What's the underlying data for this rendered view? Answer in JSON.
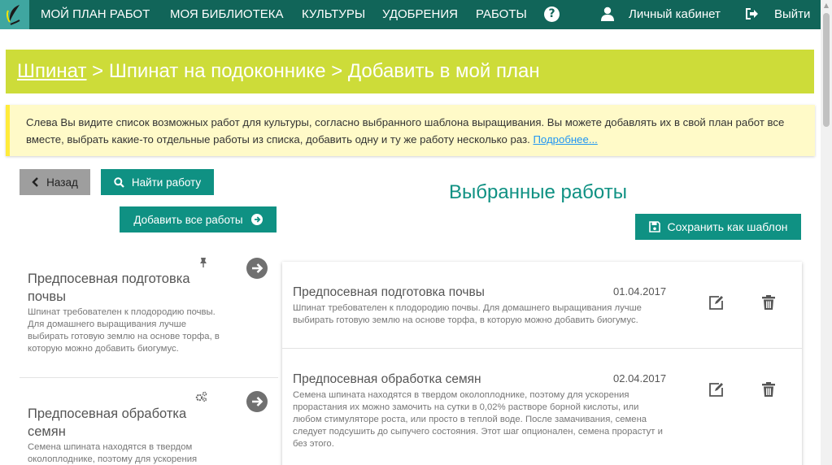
{
  "navbar": {
    "logo_icon": "leaf-logo-icon",
    "items": [
      "МОЙ ПЛАН РАБОТ",
      "МОЯ БИБЛИОТЕКА",
      "КУЛЬТУРЫ",
      "УДОБРЕНИЯ",
      "РАБОТЫ"
    ],
    "help_glyph": "?",
    "account_label": "Личный кабинет",
    "logout_label": "Выйти",
    "bg_color": "#116559"
  },
  "breadcrumb": {
    "link": "Шпинат",
    "rest": " > Шпинат на подоконнике > Добавить в мой план",
    "bg_color": "#cddc39"
  },
  "info": {
    "text": "Слева Вы видите список возможных работ для культуры, согласно выбранного шаблона выращивания. Вы можете добавлять их в свой план работ все вместе, выбрать какие-то отдельные работы из списка, добавить одну и ту же работу несколько раз.",
    "link": "Подробнее..."
  },
  "buttons": {
    "back": "Назад",
    "find": "Найти работу",
    "add_all": "Добавить все работы",
    "save_template": "Сохранить как шаблон"
  },
  "selected_title": "Выбранные работы",
  "available_works": [
    {
      "title": "Предпосевная подготовка почвы",
      "description": "Шпинат требователен к плодородию почвы. Для домашнего выращивания лучше выбирать готовую землю на основе торфа, в которую можно добавить биогумус.",
      "icon": "pin-icon"
    },
    {
      "title": "Предпосевная обработка семян",
      "description": "Семена шпината находятся в твердом околоплоднике, поэтому для ускорения",
      "icon": "gears-icon"
    }
  ],
  "selected_works": [
    {
      "title": "Предпосевная подготовка почвы",
      "date": "01.04.2017",
      "description": "Шпинат требователен к плодородию почвы. Для домашнего выращивания лучше выбирать готовую землю на основе торфа, в которую можно добавить биогумус."
    },
    {
      "title": "Предпосевная обработка семян",
      "date": "02.04.2017",
      "description": "Семена шпината находятся в твердом околоплоднике, поэтому для ускорения прорастания их можно замочить на сутки в 0,02% растворе борной кислоты, или любом стимуляторе роста, или просто в теплой воде. После замачивания, семена следует подсушить до сыпучего состояния. Этот шаг опционален, семена прорастут и без этого."
    }
  ]
}
